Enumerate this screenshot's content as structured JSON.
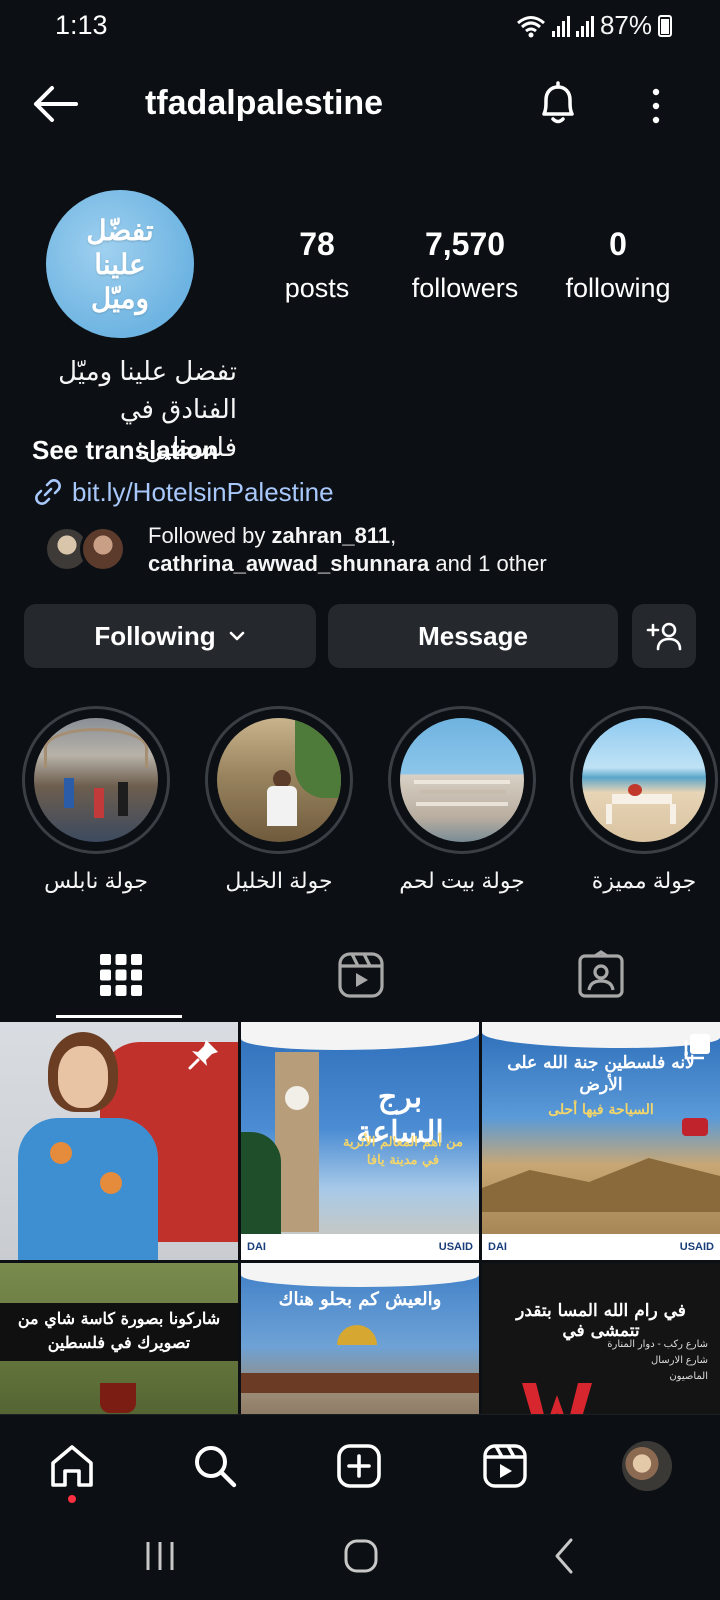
{
  "status_bar": {
    "time": "1:13",
    "battery": "87%"
  },
  "header": {
    "username": "tfadalpalestine"
  },
  "profile": {
    "avatar_text": [
      "تفضّل",
      "علينا",
      "وميّل"
    ],
    "stats": [
      {
        "value": "78",
        "label": "posts"
      },
      {
        "value": "7,570",
        "label": "followers"
      },
      {
        "value": "0",
        "label": "following"
      }
    ],
    "bio": {
      "line1": "تفضل علينا وميّل",
      "line2": "الفنادق في فلسطين:",
      "see_translation": "See translation",
      "link": "bit.ly/HotelsinPalestine"
    },
    "followed_by": {
      "prefix": "Followed by ",
      "user1": "zahran_811",
      "comma": ",",
      "user2": "cathrina_awwad_shunnara",
      "suffix": " and 1 other"
    }
  },
  "actions": {
    "following_label": "Following",
    "message_label": "Message"
  },
  "highlights": [
    {
      "label": "جولة نابلس"
    },
    {
      "label": "جولة الخليل"
    },
    {
      "label": "جولة بيت لحم"
    },
    {
      "label": "جولة مميزة"
    }
  ],
  "grid": {
    "tile2_title": "برج الساعة",
    "tile2_sub": "من أهم المعالم الأثرية في مدينة يافا",
    "tile3_title": "لأنه فلسطين جنة الله على الأرض",
    "tile3_sub": "السياحة فيها أحلى",
    "tile4_text": "شاركونا بصورة كاسة شاي من تصويرك في فلسطين",
    "tile5_text": "والعيش كم بحلو هناك",
    "tile6_text": "في رام الله المسا بتقدر تتمشى في",
    "tile6_sub1": "شارع ركب - دوار المنارة",
    "tile6_sub2": "شارع الارسال",
    "tile6_sub3": "الماصيون",
    "badge_usaid": "USAID",
    "badge_dai": "DAI"
  },
  "colors": {
    "background": "#0c1014",
    "button": "#25292e",
    "link": "#a8c7fa",
    "notification_dot": "#ff3040"
  }
}
